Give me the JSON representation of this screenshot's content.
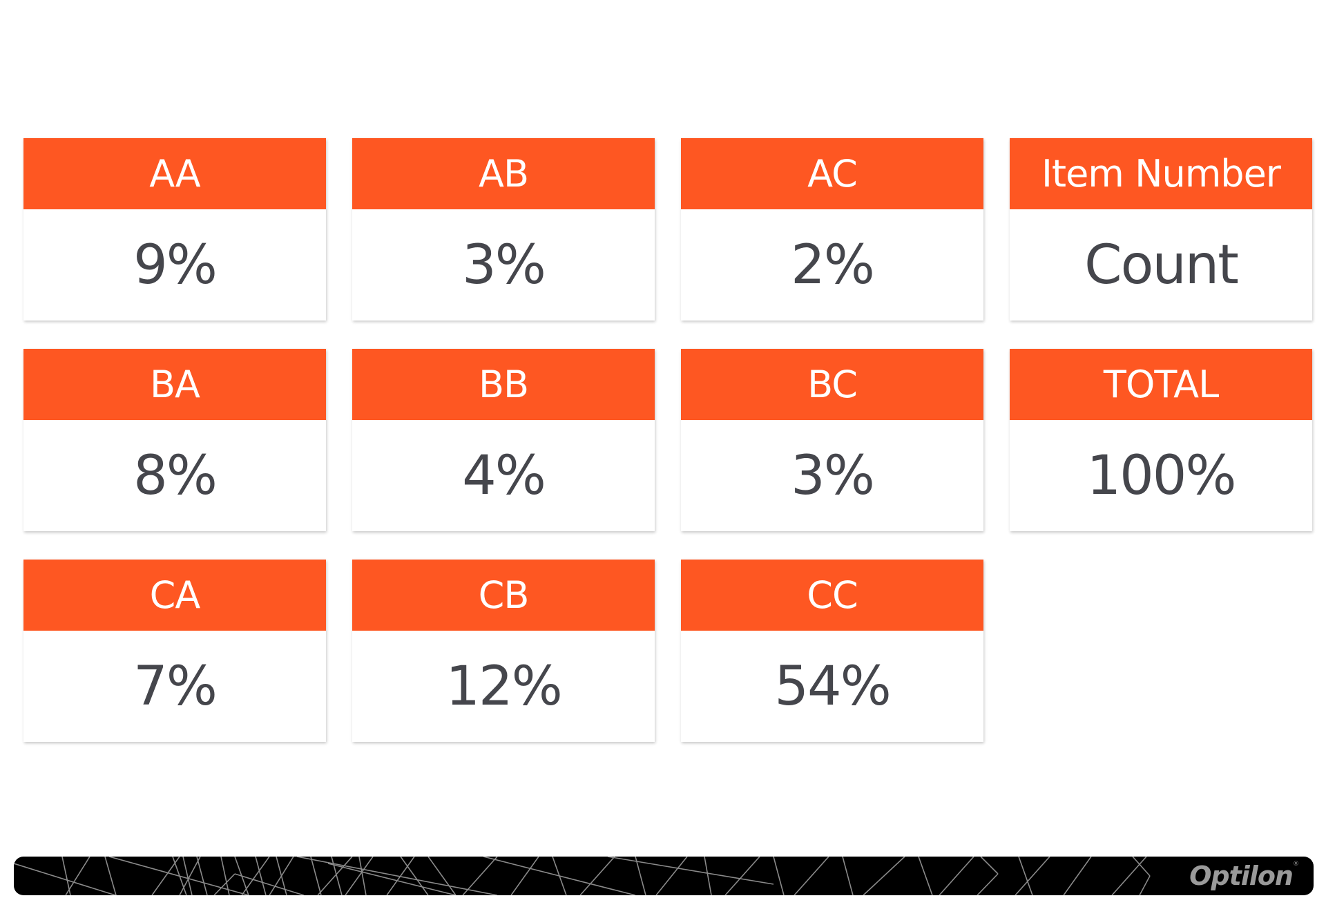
{
  "accent_color": "#fe5722",
  "cards": [
    {
      "label": "AA",
      "value": "9%"
    },
    {
      "label": "AB",
      "value": "3%"
    },
    {
      "label": "AC",
      "value": "2%"
    },
    {
      "label": "Item Number",
      "value": "Count"
    },
    {
      "label": "BA",
      "value": "8%"
    },
    {
      "label": "BB",
      "value": "4%"
    },
    {
      "label": "BC",
      "value": "3%"
    },
    {
      "label": "TOTAL",
      "value": "100%"
    },
    {
      "label": "CA",
      "value": "7%"
    },
    {
      "label": "CB",
      "value": "12%"
    },
    {
      "label": "CC",
      "value": "54%"
    }
  ],
  "footer": {
    "brand": "Optilon",
    "registered_mark": "®"
  }
}
